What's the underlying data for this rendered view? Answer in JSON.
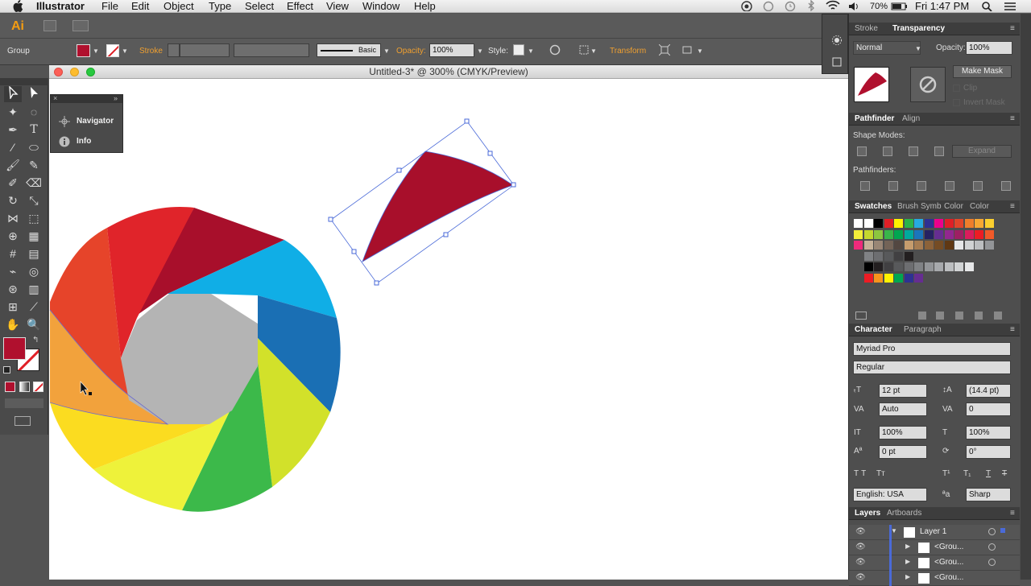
{
  "menubar": {
    "app_name": "Illustrator",
    "items": [
      "File",
      "Edit",
      "Object",
      "Type",
      "Select",
      "Effect",
      "View",
      "Window",
      "Help"
    ],
    "battery": "70%",
    "clock": "Fri 1:47 PM"
  },
  "app": {
    "logo": "Ai"
  },
  "controlbar": {
    "selection_type": "Group",
    "stroke_label": "Stroke",
    "brush_label": "Basic",
    "opacity_label": "Opacity:",
    "opacity_value": "100%",
    "style_label": "Style:",
    "transform_label": "Transform"
  },
  "document": {
    "title": "Untitled-3* @ 300% (CMYK/Preview)"
  },
  "navigator_panel": {
    "items": [
      "Navigator",
      "Info"
    ]
  },
  "transparency_panel": {
    "tabs": [
      "Stroke",
      "Transparency"
    ],
    "blend_mode": "Normal",
    "opacity_label": "Opacity:",
    "opacity_value": "100%",
    "make_mask": "Make Mask",
    "clip": "Clip",
    "invert_mask": "Invert Mask"
  },
  "pathfinder_panel": {
    "tabs": [
      "Pathfinder",
      "Align"
    ],
    "shape_modes": "Shape Modes:",
    "pathfinders": "Pathfinders:",
    "expand": "Expand"
  },
  "swatches_panel": {
    "tabs": [
      "Swatches",
      "Brush",
      "Symb",
      "Color",
      "Color"
    ]
  },
  "character_panel": {
    "tabs": [
      "Character",
      "Paragraph"
    ],
    "font_family": "Myriad Pro",
    "font_style": "Regular",
    "font_size": "12 pt",
    "leading": "(14.4 pt)",
    "kerning": "Auto",
    "tracking": "0",
    "vscale": "100%",
    "hscale": "100%",
    "baseline": "0 pt",
    "rotation": "0°",
    "language": "English: USA",
    "antialias": "Sharp"
  },
  "layers_panel": {
    "tabs": [
      "Layers",
      "Artboards"
    ],
    "rows": [
      "Layer 1",
      "<Grou...",
      "<Grou...",
      "<Grou..."
    ]
  },
  "colors": {
    "fill": "#b0102e",
    "selection": "#4a6ad8",
    "wheel": [
      "#e0242a",
      "#a80f2b",
      "#10aee6",
      "#1a6fb4",
      "#d2e12a",
      "#3cb94a",
      "#eef23a",
      "#fbdc20",
      "#f2a23c",
      "#e6442a",
      "#b4b4b4"
    ]
  }
}
